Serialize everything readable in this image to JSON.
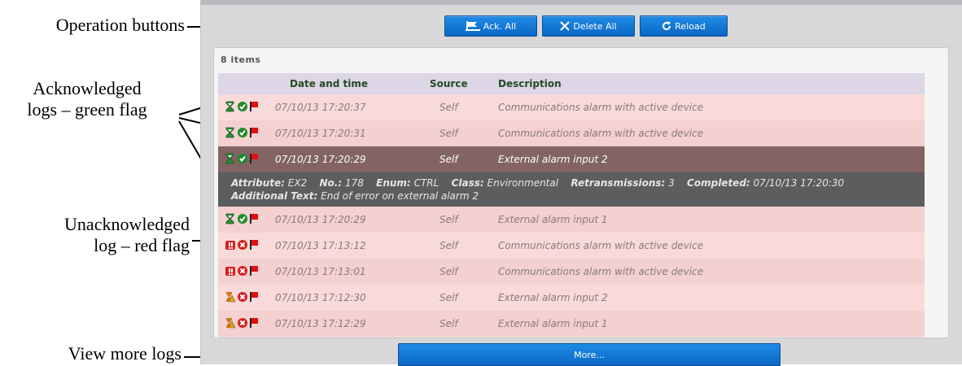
{
  "annotations": {
    "operation_buttons": "Operation buttons",
    "ack_line1": "Acknowledged",
    "ack_line2": "logs – green flag",
    "unack_line1": "Unacknowledged",
    "unack_line2": "log – red flag",
    "view_more": "View more logs"
  },
  "toolbar": {
    "ack_all": "Ack. All",
    "delete_all": "Delete All",
    "reload": "Reload"
  },
  "list": {
    "count_label": "8 items",
    "columns": {
      "datetime": "Date and time",
      "source": "Source",
      "description": "Description"
    },
    "rows": [
      {
        "datetime": "07/10/13 17:20:37",
        "source": "Self",
        "description": "Communications alarm with active device",
        "ack": true,
        "type": "comm"
      },
      {
        "datetime": "07/10/13 17:20:31",
        "source": "Self",
        "description": "Communications alarm with active device",
        "ack": true,
        "type": "comm"
      },
      {
        "datetime": "07/10/13 17:20:29",
        "source": "Self",
        "description": "External alarm input 2",
        "ack": true,
        "type": "ext",
        "selected": true
      },
      {
        "datetime": "07/10/13 17:20:29",
        "source": "Self",
        "description": "External alarm input 1",
        "ack": true,
        "type": "ext"
      },
      {
        "datetime": "07/10/13 17:13:12",
        "source": "Self",
        "description": "Communications alarm with active device",
        "ack": false,
        "type": "comm"
      },
      {
        "datetime": "07/10/13 17:13:01",
        "source": "Self",
        "description": "Communications alarm with active device",
        "ack": false,
        "type": "comm"
      },
      {
        "datetime": "07/10/13 17:12:30",
        "source": "Self",
        "description": "External alarm input 2",
        "ack": false,
        "type": "ext"
      },
      {
        "datetime": "07/10/13 17:12:29",
        "source": "Self",
        "description": "External alarm input 1",
        "ack": false,
        "type": "ext"
      }
    ],
    "details": {
      "attribute_label": "Attribute:",
      "attribute": "EX2",
      "no_label": "No.:",
      "no": "178",
      "enum_label": "Enum:",
      "enum": "CTRL",
      "class_label": "Class:",
      "class": "Environmental",
      "retrans_label": "Retransmissions:",
      "retrans": "3",
      "completed_label": "Completed:",
      "completed": "07/10/13 17:20:30",
      "additional_label": "Additional Text:",
      "additional": "End of error on external alarm 2"
    }
  },
  "more_button": "More...",
  "colors": {
    "button_blue": "#0b67c5",
    "ack_green": "#1c8a2c",
    "unack_red": "#d62020",
    "flag_red": "#e01010",
    "selected_row": "#836364"
  }
}
